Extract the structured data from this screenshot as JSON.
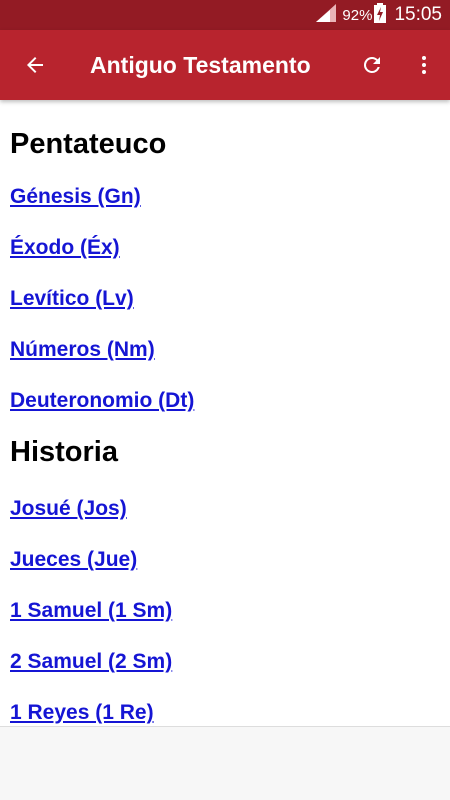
{
  "status_bar": {
    "battery_percent": "92%",
    "time": "15:05"
  },
  "app_bar": {
    "title": "Antiguo Testamento",
    "icons": [
      "back-arrow-icon",
      "refresh-icon",
      "overflow-menu-icon"
    ]
  },
  "sections": [
    {
      "heading": "Pentateuco",
      "books": [
        "Génesis (Gn)",
        "Éxodo (Éx)",
        "Levítico (Lv)",
        "Números (Nm)",
        "Deuteronomio (Dt)"
      ]
    },
    {
      "heading": "Historia",
      "books": [
        "Josué (Jos)",
        "Jueces (Jue)",
        "1 Samuel (1 Sm)",
        "2 Samuel (2 Sm)",
        "1 Reyes (1 Re)"
      ]
    }
  ],
  "colors": {
    "status_bar": "#931b24",
    "app_bar": "#b8242e",
    "link": "#1515d4"
  }
}
